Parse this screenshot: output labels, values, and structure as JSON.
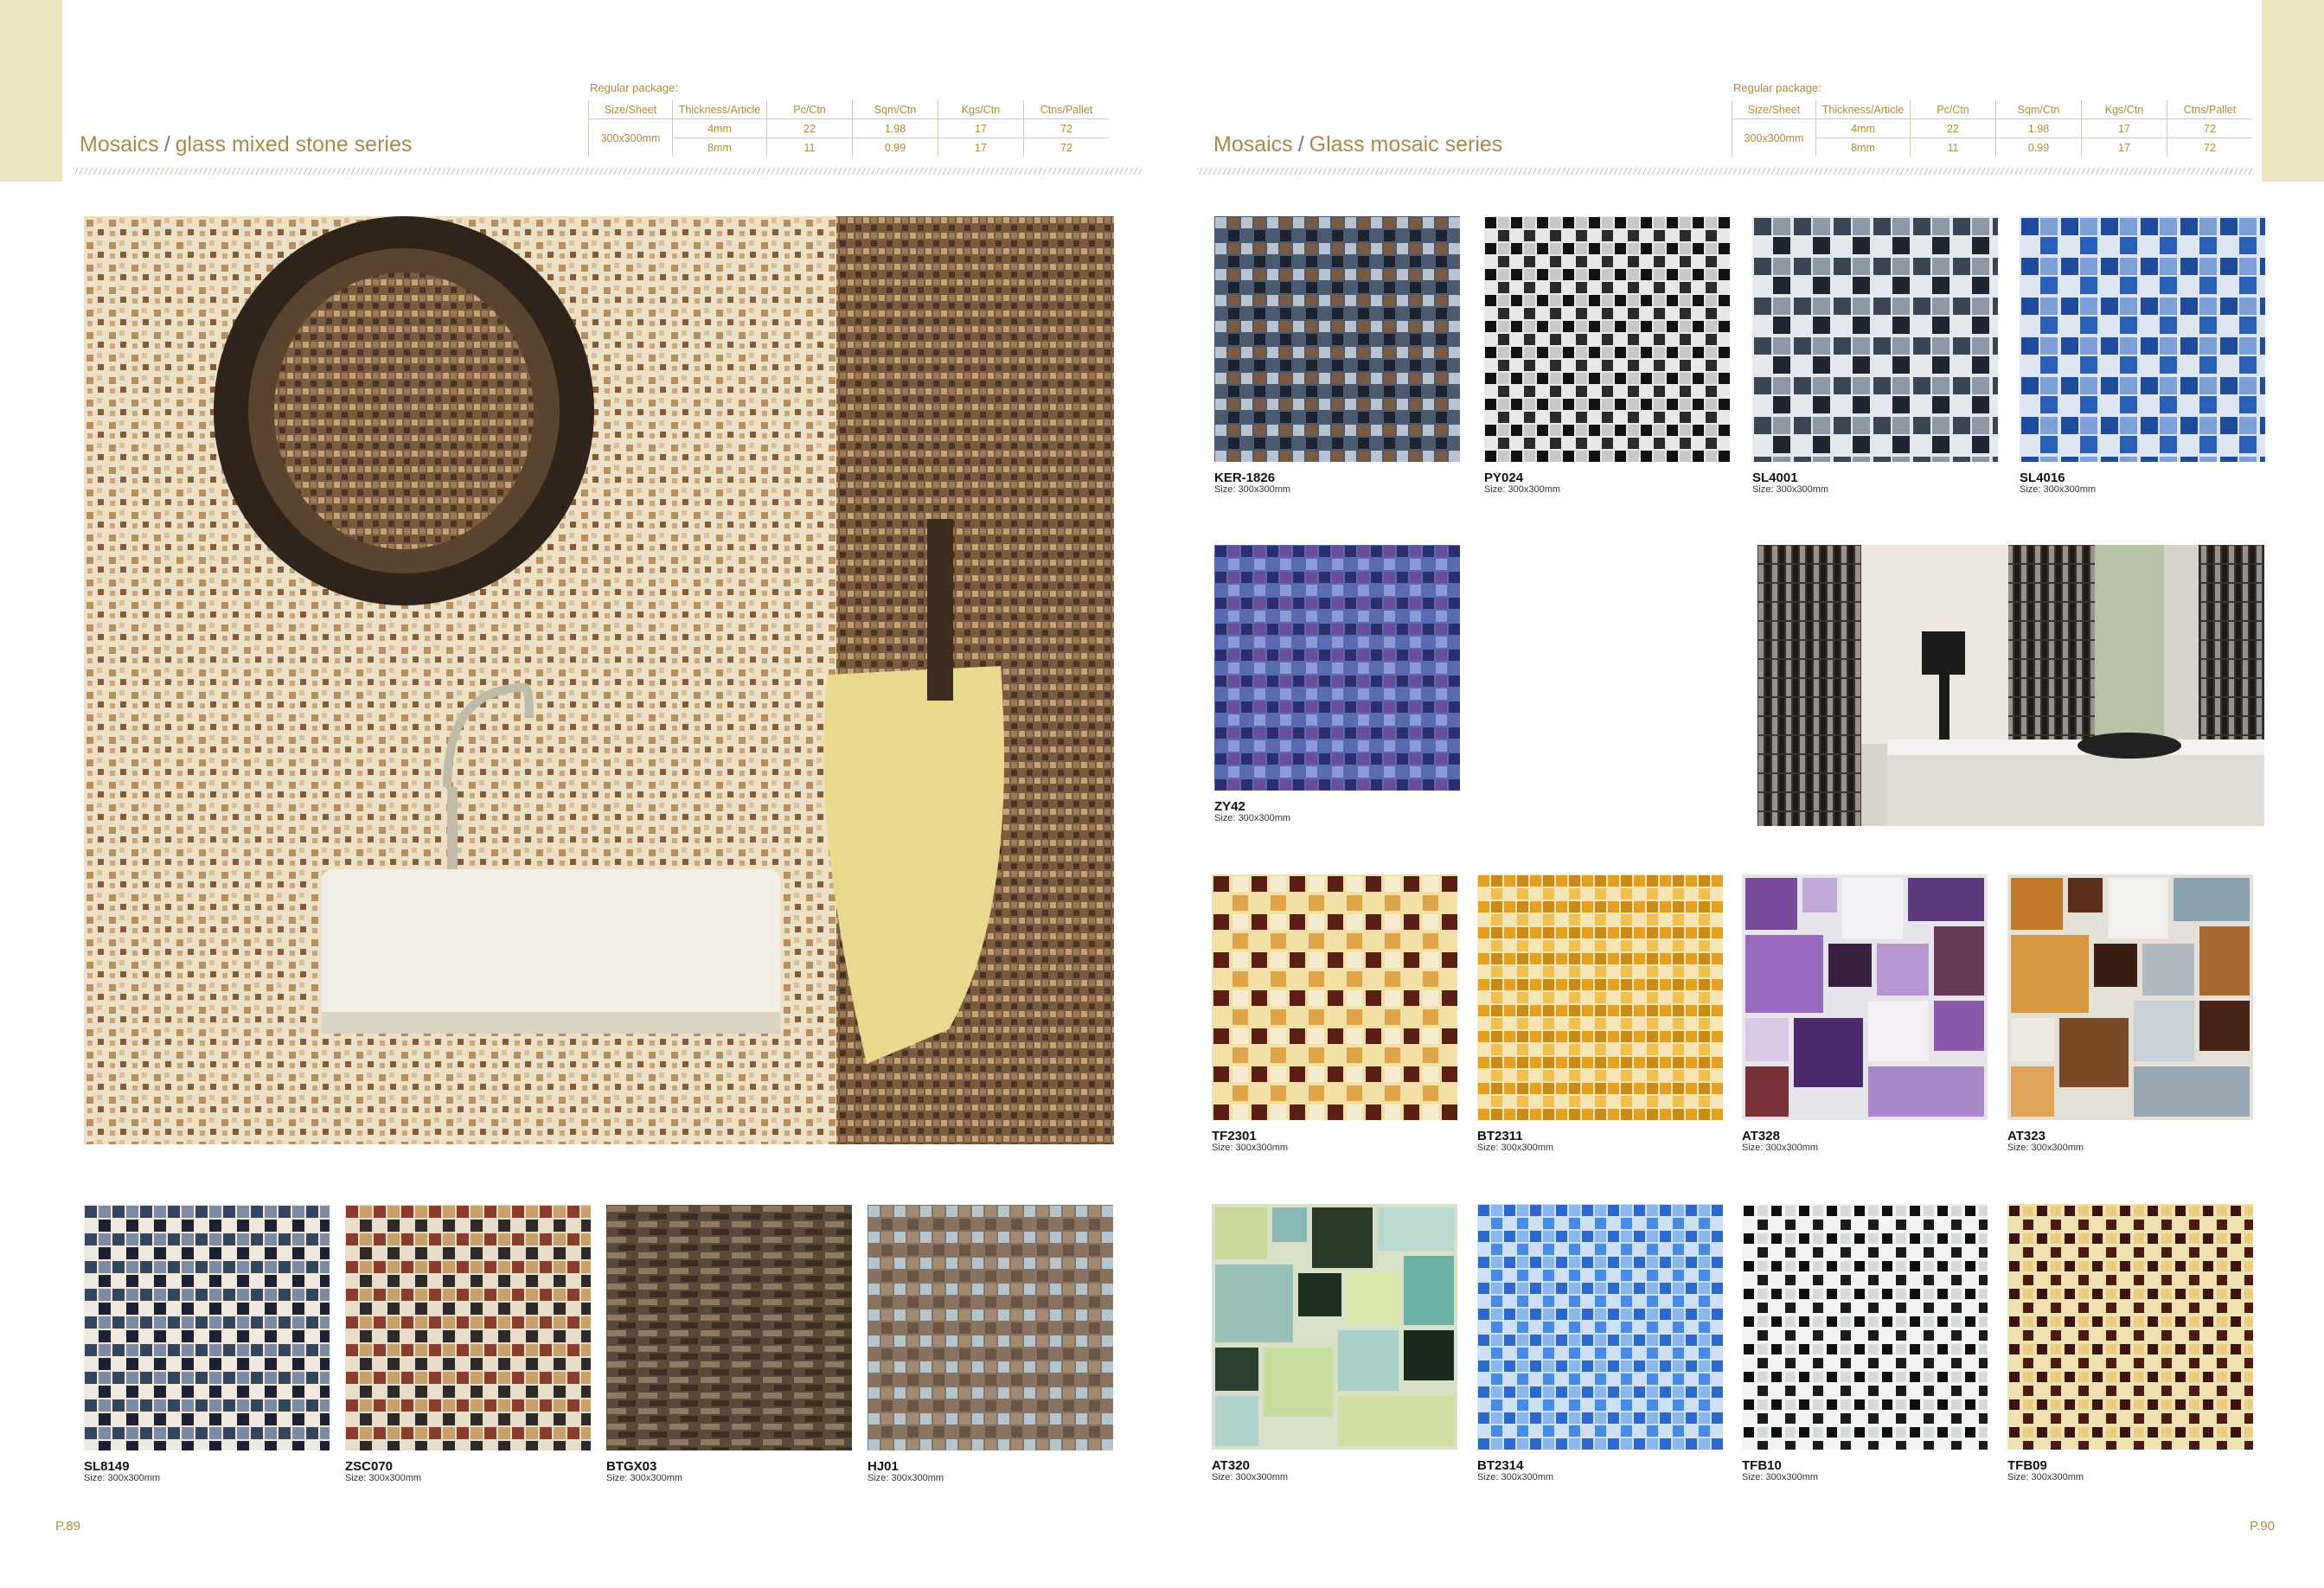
{
  "left_page": {
    "package_label": "Regular package:",
    "headers": [
      "Size/Sheet",
      "Thickness/Article",
      "Pc/Ctn",
      "Sqm/Ctn",
      "Kgs/Ctn",
      "Ctns/Pallet"
    ],
    "size_sheet": "300x300mm",
    "rows": [
      [
        "4mm",
        "22",
        "1.98",
        "17",
        "72"
      ],
      [
        "8mm",
        "11",
        "0.99",
        "17",
        "72"
      ]
    ],
    "title_main": "Mosaics",
    "title_series": "glass mixed stone series",
    "page_number": "P.89",
    "tiles": [
      {
        "code": "SL8149",
        "size": "Size: 300x300mm"
      },
      {
        "code": "ZSC070",
        "size": "Size: 300x300mm"
      },
      {
        "code": "BTGX03",
        "size": "Size: 300x300mm"
      },
      {
        "code": "HJ01",
        "size": "Size: 300x300mm"
      }
    ]
  },
  "right_page": {
    "package_label": "Regular package:",
    "headers": [
      "Size/Sheet",
      "Thickness/Article",
      "Pc/Ctn",
      "Sqm/Ctn",
      "Kgs/Ctn",
      "Ctns/Pallet"
    ],
    "size_sheet": "300x300mm",
    "rows": [
      [
        "4mm",
        "22",
        "1.98",
        "17",
        "72"
      ],
      [
        "8mm",
        "11",
        "0.99",
        "17",
        "72"
      ]
    ],
    "title_main": "Mosaics",
    "title_series": "Glass mosaic series",
    "page_number": "P.90",
    "tiles": [
      {
        "code": "KER-1826",
        "size": "Size: 300x300mm"
      },
      {
        "code": "PY024",
        "size": "Size: 300x300mm"
      },
      {
        "code": "SL4001",
        "size": "Size: 300x300mm"
      },
      {
        "code": "SL4016",
        "size": "Size: 300x300mm"
      },
      {
        "code": "ZY42",
        "size": "Size: 300x300mm"
      },
      {
        "code": "TF2301",
        "size": "Size: 300x300mm"
      },
      {
        "code": "BT2311",
        "size": "Size: 300x300mm"
      },
      {
        "code": "AT328",
        "size": "Size: 300x300mm"
      },
      {
        "code": "AT323",
        "size": "Size: 300x300mm"
      },
      {
        "code": "AT320",
        "size": "Size: 300x300mm"
      },
      {
        "code": "BT2314",
        "size": "Size: 300x300mm"
      },
      {
        "code": "TFB10",
        "size": "Size: 300x300mm"
      },
      {
        "code": "TFB09",
        "size": "Size: 300x300mm"
      }
    ]
  }
}
